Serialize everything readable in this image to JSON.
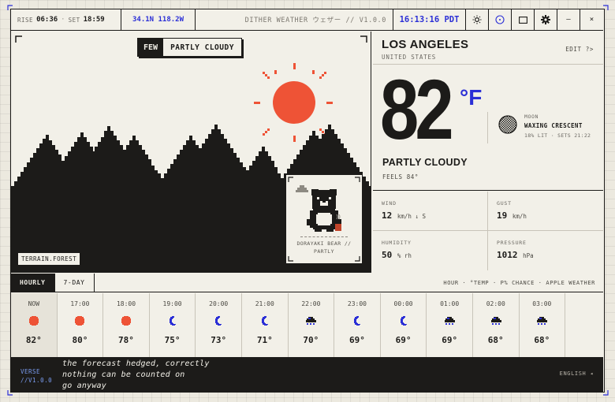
{
  "topbar": {
    "rise_label": "RISE",
    "rise_time": "06:36",
    "set_label": "SET",
    "set_time": "18:59",
    "separator": "·",
    "coords": "34.1N 118.2W",
    "app_title": "DITHER WEATHER ウェザー // V1.0.0",
    "clock": "16:13:16 PDT",
    "buttons": [
      "sun-icon",
      "compass-icon",
      "window-icon",
      "gear-icon"
    ],
    "minimize_label": "–",
    "close_label": "×"
  },
  "scene": {
    "badge_key": "FEW",
    "badge_value": "PARTLY CLOUDY",
    "terrain_label": "TERRAIN.FOREST",
    "bear_caption_line1": "DORAYAKI BEAR //",
    "bear_caption_line2": "PARTLY",
    "colors": {
      "sun": "#ee5336",
      "ink": "#1c1b19",
      "paper": "#f2f0e8"
    }
  },
  "location": {
    "city": "LOS ANGELES",
    "country": "UNITED STATES",
    "edit_label": "EDIT ?>"
  },
  "current": {
    "temp": "82",
    "unit": "°F",
    "condition": "PARTLY CLOUDY",
    "feels_like": "FEELS 84°"
  },
  "moon": {
    "label": "MOON",
    "phase": "WAXING CRESCENT",
    "meta": "18% LIT · SETS 21:22"
  },
  "stats": {
    "wind": {
      "label": "WIND",
      "value": "12",
      "unit": "km/h ↓ S"
    },
    "gust": {
      "label": "GUST",
      "value": "19",
      "unit": "km/h"
    },
    "humidity": {
      "label": "HUMIDITY",
      "value": "50",
      "unit": "% rh"
    },
    "pressure": {
      "label": "PRESSURE",
      "value": "1012",
      "unit": "hPa"
    }
  },
  "tabs": {
    "hourly": "HOURLY",
    "week": "7-DAY",
    "meta": "HOUR · °TEMP · P% CHANCE · APPLE WEATHER"
  },
  "hourly": [
    {
      "time": "NOW",
      "icon": "sun",
      "temp": "82°"
    },
    {
      "time": "17:00",
      "icon": "sun",
      "temp": "80°"
    },
    {
      "time": "18:00",
      "icon": "sun",
      "temp": "78°"
    },
    {
      "time": "19:00",
      "icon": "moon",
      "temp": "75°"
    },
    {
      "time": "20:00",
      "icon": "moon",
      "temp": "73°"
    },
    {
      "time": "21:00",
      "icon": "moon",
      "temp": "71°"
    },
    {
      "time": "22:00",
      "icon": "cloud",
      "temp": "70°"
    },
    {
      "time": "23:00",
      "icon": "moon",
      "temp": "69°"
    },
    {
      "time": "00:00",
      "icon": "moon",
      "temp": "69°"
    },
    {
      "time": "01:00",
      "icon": "cloud",
      "temp": "69°"
    },
    {
      "time": "02:00",
      "icon": "cloud",
      "temp": "68°"
    },
    {
      "time": "03:00",
      "icon": "cloud",
      "temp": "68°"
    }
  ],
  "footer": {
    "verse_label": "VERSE",
    "verse_version": "//V1.0.0",
    "lines": [
      "the forecast hedged, correctly",
      "nothing can be counted on",
      "go anyway"
    ],
    "language": "ENGLISH ◂"
  }
}
